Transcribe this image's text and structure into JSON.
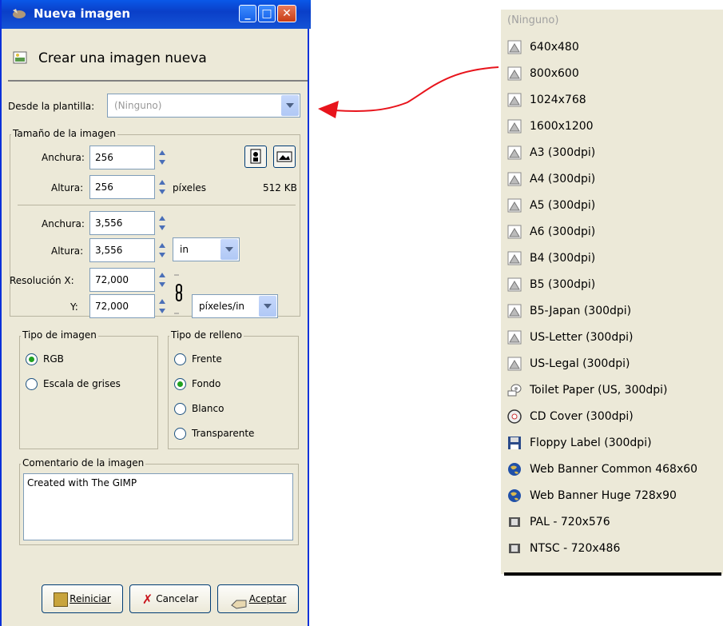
{
  "window": {
    "title": "Nueva imagen",
    "header": "Crear una imagen nueva"
  },
  "template": {
    "label": "Desde la plantilla:",
    "value": "(Ninguno)"
  },
  "size_group": {
    "title": "Tamaño de la imagen",
    "width_label": "Anchura:",
    "width_value": "256",
    "height_label": "Altura:",
    "height_value": "256",
    "unit": "píxeles",
    "memory": "512 KB"
  },
  "advanced": {
    "width_label": "Anchura:",
    "width_value": "3,556",
    "height_label": "Altura:",
    "height_value": "3,556",
    "unit": "in",
    "res_x_label": "Resolución X:",
    "res_x_value": "72,000",
    "res_y_label": "Y:",
    "res_y_value": "72,000",
    "res_unit": "píxeles/in"
  },
  "image_type": {
    "title": "Tipo de imagen",
    "options": [
      "RGB",
      "Escala de grises"
    ],
    "selected": "RGB"
  },
  "fill_type": {
    "title": "Tipo de relleno",
    "options": [
      "Frente",
      "Fondo",
      "Blanco",
      "Transparente"
    ],
    "selected": "Fondo"
  },
  "comment": {
    "title": "Comentario de la imagen",
    "value": "Created with The GIMP"
  },
  "buttons": {
    "reset": "Reiniciar",
    "cancel": "Cancelar",
    "ok": "Aceptar"
  },
  "template_list": [
    {
      "label": "(Ninguno)",
      "icon": "none"
    },
    {
      "label": "640x480",
      "icon": "document-icon"
    },
    {
      "label": "800x600",
      "icon": "document-icon"
    },
    {
      "label": "1024x768",
      "icon": "document-icon"
    },
    {
      "label": "1600x1200",
      "icon": "document-icon"
    },
    {
      "label": "A3 (300dpi)",
      "icon": "document-icon"
    },
    {
      "label": "A4 (300dpi)",
      "icon": "document-icon"
    },
    {
      "label": "A5 (300dpi)",
      "icon": "document-icon"
    },
    {
      "label": "A6 (300dpi)",
      "icon": "document-icon"
    },
    {
      "label": "B4 (300dpi)",
      "icon": "document-icon"
    },
    {
      "label": "B5 (300dpi)",
      "icon": "document-icon"
    },
    {
      "label": "B5-Japan (300dpi)",
      "icon": "document-icon"
    },
    {
      "label": "US-Letter (300dpi)",
      "icon": "document-icon"
    },
    {
      "label": "US-Legal (300dpi)",
      "icon": "document-icon"
    },
    {
      "label": "Toilet Paper (US, 300dpi)",
      "icon": "toilet-paper-icon"
    },
    {
      "label": "CD Cover (300dpi)",
      "icon": "cd-icon"
    },
    {
      "label": "Floppy Label (300dpi)",
      "icon": "floppy-icon"
    },
    {
      "label": "Web Banner Common 468x60",
      "icon": "globe-icon"
    },
    {
      "label": "Web Banner Huge 728x90",
      "icon": "globe-icon"
    },
    {
      "label": "PAL - 720x576",
      "icon": "film-icon"
    },
    {
      "label": "NTSC - 720x486",
      "icon": "film-icon"
    }
  ],
  "colors": {
    "title_bar": "#0a48dc",
    "dialog_bg": "#ece9d8",
    "arrow": "#e8141c"
  }
}
